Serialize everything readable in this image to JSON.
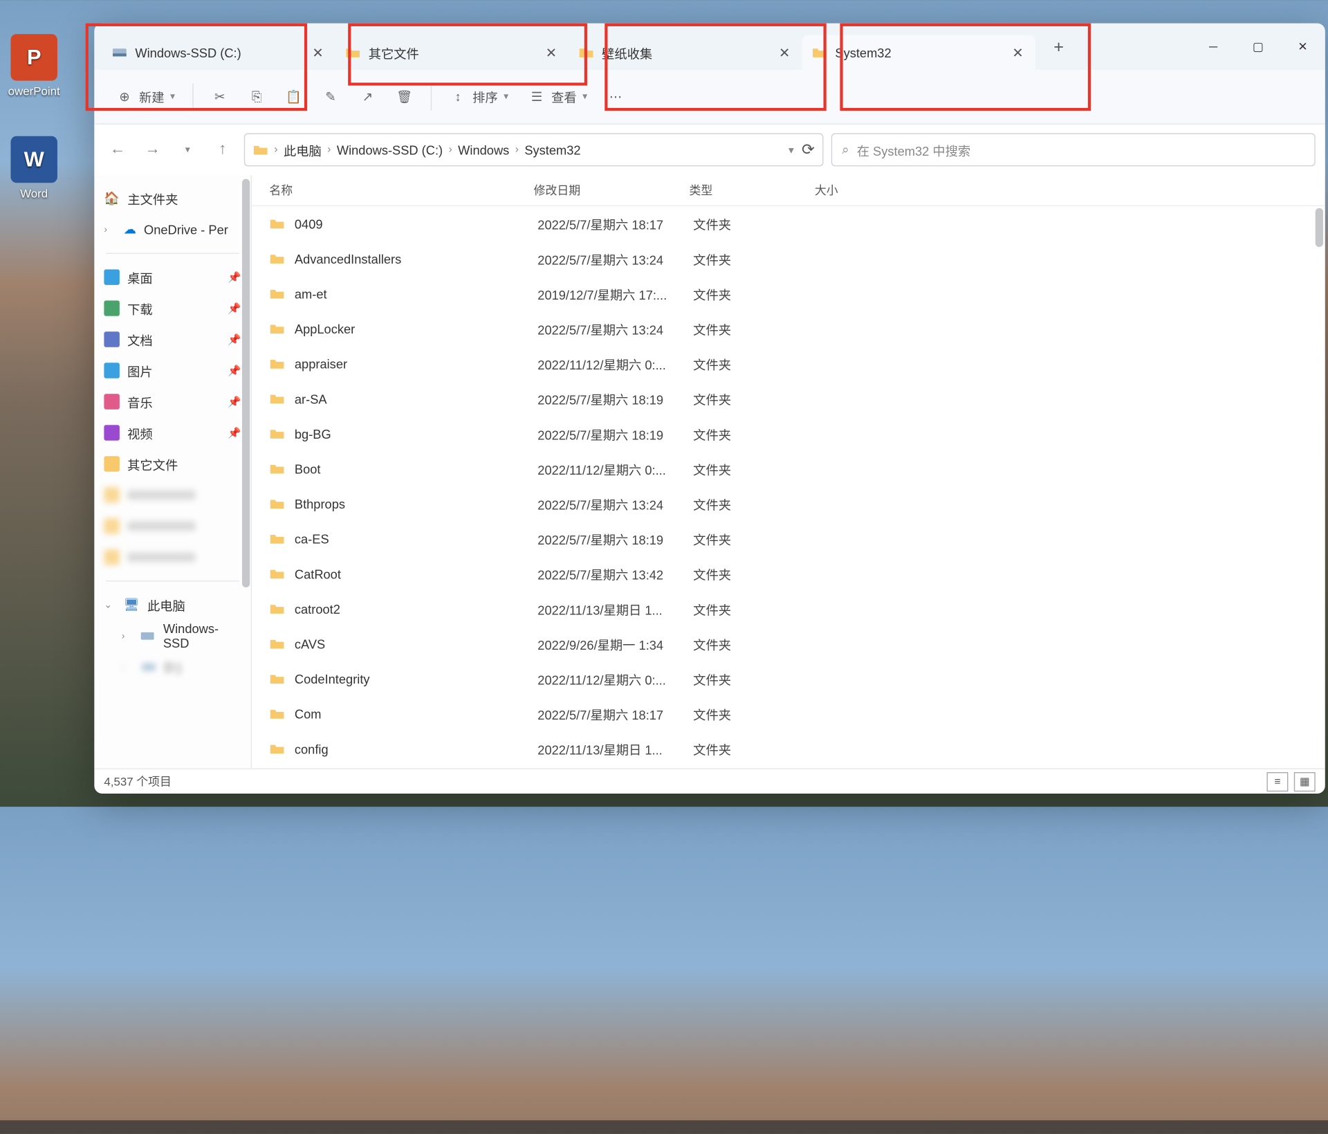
{
  "desktop": {
    "powerpoint_label": "owerPoint",
    "powerpoint_letter": "P",
    "word_label": "Word",
    "word_letter": "W"
  },
  "tabs": [
    {
      "label": "Windows-SSD (C:)",
      "active": false,
      "type": "drive"
    },
    {
      "label": "其它文件",
      "active": false,
      "type": "folder"
    },
    {
      "label": "壁纸收集",
      "active": false,
      "type": "folder"
    },
    {
      "label": "System32",
      "active": true,
      "type": "folder"
    }
  ],
  "toolbar": {
    "new_label": "新建",
    "sort_label": "排序",
    "view_label": "查看"
  },
  "breadcrumb": [
    "此电脑",
    "Windows-SSD (C:)",
    "Windows",
    "System32"
  ],
  "search_placeholder": "在 System32 中搜索",
  "sidebar": {
    "home": "主文件夹",
    "onedrive": "OneDrive - Per",
    "quick": [
      {
        "label": "桌面",
        "color": "#3aa0e0"
      },
      {
        "label": "下载",
        "color": "#4aa36a"
      },
      {
        "label": "文档",
        "color": "#6076c6"
      },
      {
        "label": "图片",
        "color": "#3aa0e0"
      },
      {
        "label": "音乐",
        "color": "#e05a8a"
      },
      {
        "label": "视频",
        "color": "#9a4ad0"
      },
      {
        "label": "其它文件",
        "color": "#f8c96a"
      }
    ],
    "this_pc": "此电脑",
    "drives": [
      {
        "label": "Windows-SSD"
      },
      {
        "label": "D:)"
      }
    ]
  },
  "columns": {
    "name": "名称",
    "date": "修改日期",
    "type": "类型",
    "size": "大小"
  },
  "files": [
    {
      "name": "0409",
      "date": "2022/5/7/星期六 18:17",
      "type": "文件夹"
    },
    {
      "name": "AdvancedInstallers",
      "date": "2022/5/7/星期六 13:24",
      "type": "文件夹"
    },
    {
      "name": "am-et",
      "date": "2019/12/7/星期六 17:...",
      "type": "文件夹"
    },
    {
      "name": "AppLocker",
      "date": "2022/5/7/星期六 13:24",
      "type": "文件夹"
    },
    {
      "name": "appraiser",
      "date": "2022/11/12/星期六 0:...",
      "type": "文件夹"
    },
    {
      "name": "ar-SA",
      "date": "2022/5/7/星期六 18:19",
      "type": "文件夹"
    },
    {
      "name": "bg-BG",
      "date": "2022/5/7/星期六 18:19",
      "type": "文件夹"
    },
    {
      "name": "Boot",
      "date": "2022/11/12/星期六 0:...",
      "type": "文件夹"
    },
    {
      "name": "Bthprops",
      "date": "2022/5/7/星期六 13:24",
      "type": "文件夹"
    },
    {
      "name": "ca-ES",
      "date": "2022/5/7/星期六 18:19",
      "type": "文件夹"
    },
    {
      "name": "CatRoot",
      "date": "2022/5/7/星期六 13:42",
      "type": "文件夹"
    },
    {
      "name": "catroot2",
      "date": "2022/11/13/星期日 1...",
      "type": "文件夹"
    },
    {
      "name": "cAVS",
      "date": "2022/9/26/星期一 1:34",
      "type": "文件夹"
    },
    {
      "name": "CodeIntegrity",
      "date": "2022/11/12/星期六 0:...",
      "type": "文件夹"
    },
    {
      "name": "Com",
      "date": "2022/5/7/星期六 18:17",
      "type": "文件夹"
    },
    {
      "name": "config",
      "date": "2022/11/13/星期日 1...",
      "type": "文件夹"
    }
  ],
  "status": {
    "count": "4,537 个项目"
  }
}
